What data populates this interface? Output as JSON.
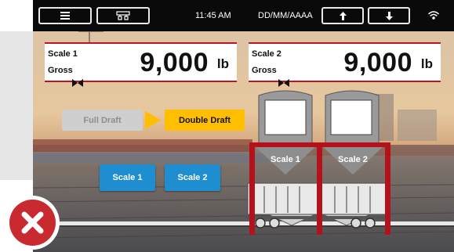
{
  "toolbar": {
    "time": "11:45 AM",
    "date_format": "DD/MM/AAAA",
    "icons": [
      "menu-icon",
      "network-icon",
      "arrow-up-icon",
      "arrow-down-icon",
      "wifi-icon"
    ]
  },
  "scales": [
    {
      "name": "Scale 1",
      "mode": "Gross",
      "value": "9,000",
      "unit": "lb"
    },
    {
      "name": "Scale 2",
      "mode": "Gross",
      "value": "9,000",
      "unit": "lb"
    }
  ],
  "draft": {
    "full_label": "Full Draft",
    "double_label": "Double Draft",
    "active": "Double Draft"
  },
  "scale_buttons": {
    "scale1": "Scale 1",
    "scale2": "Scale 2"
  },
  "diagram": {
    "hopper1": "Scale 1",
    "hopper2": "Scale 2"
  },
  "colors": {
    "accent_red": "#c1121f",
    "button_blue": "#1f8ed0",
    "active_yellow": "#ffbe00",
    "cancel_red": "#c82a30"
  }
}
